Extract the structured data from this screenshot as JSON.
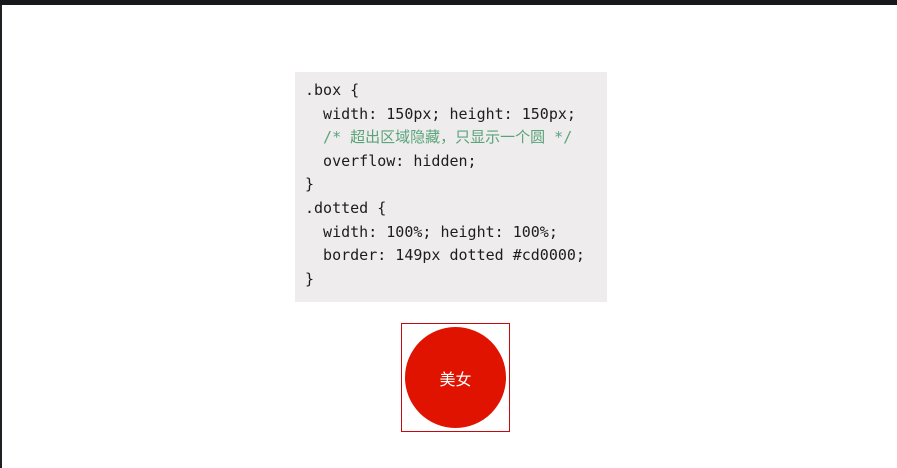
{
  "colors": {
    "top_bar": "#16191c",
    "code_background": "#eeeced",
    "code_text": "#1d1d1d",
    "comment_text": "#5aa47a",
    "frame_border": "#c7090f",
    "circle_fill": "#e01200",
    "circle_text": "#ffffff"
  },
  "code": {
    "lines": [
      ".box {",
      "  width: 150px; height: 150px;",
      "  /* 超出区域隐藏，只显示一个圆 */",
      "  overflow: hidden;",
      "}",
      ".dotted {",
      "  width: 100%; height: 100%;",
      "  border: 149px dotted #cd0000;",
      "}"
    ]
  },
  "demo": {
    "label": "美女"
  }
}
